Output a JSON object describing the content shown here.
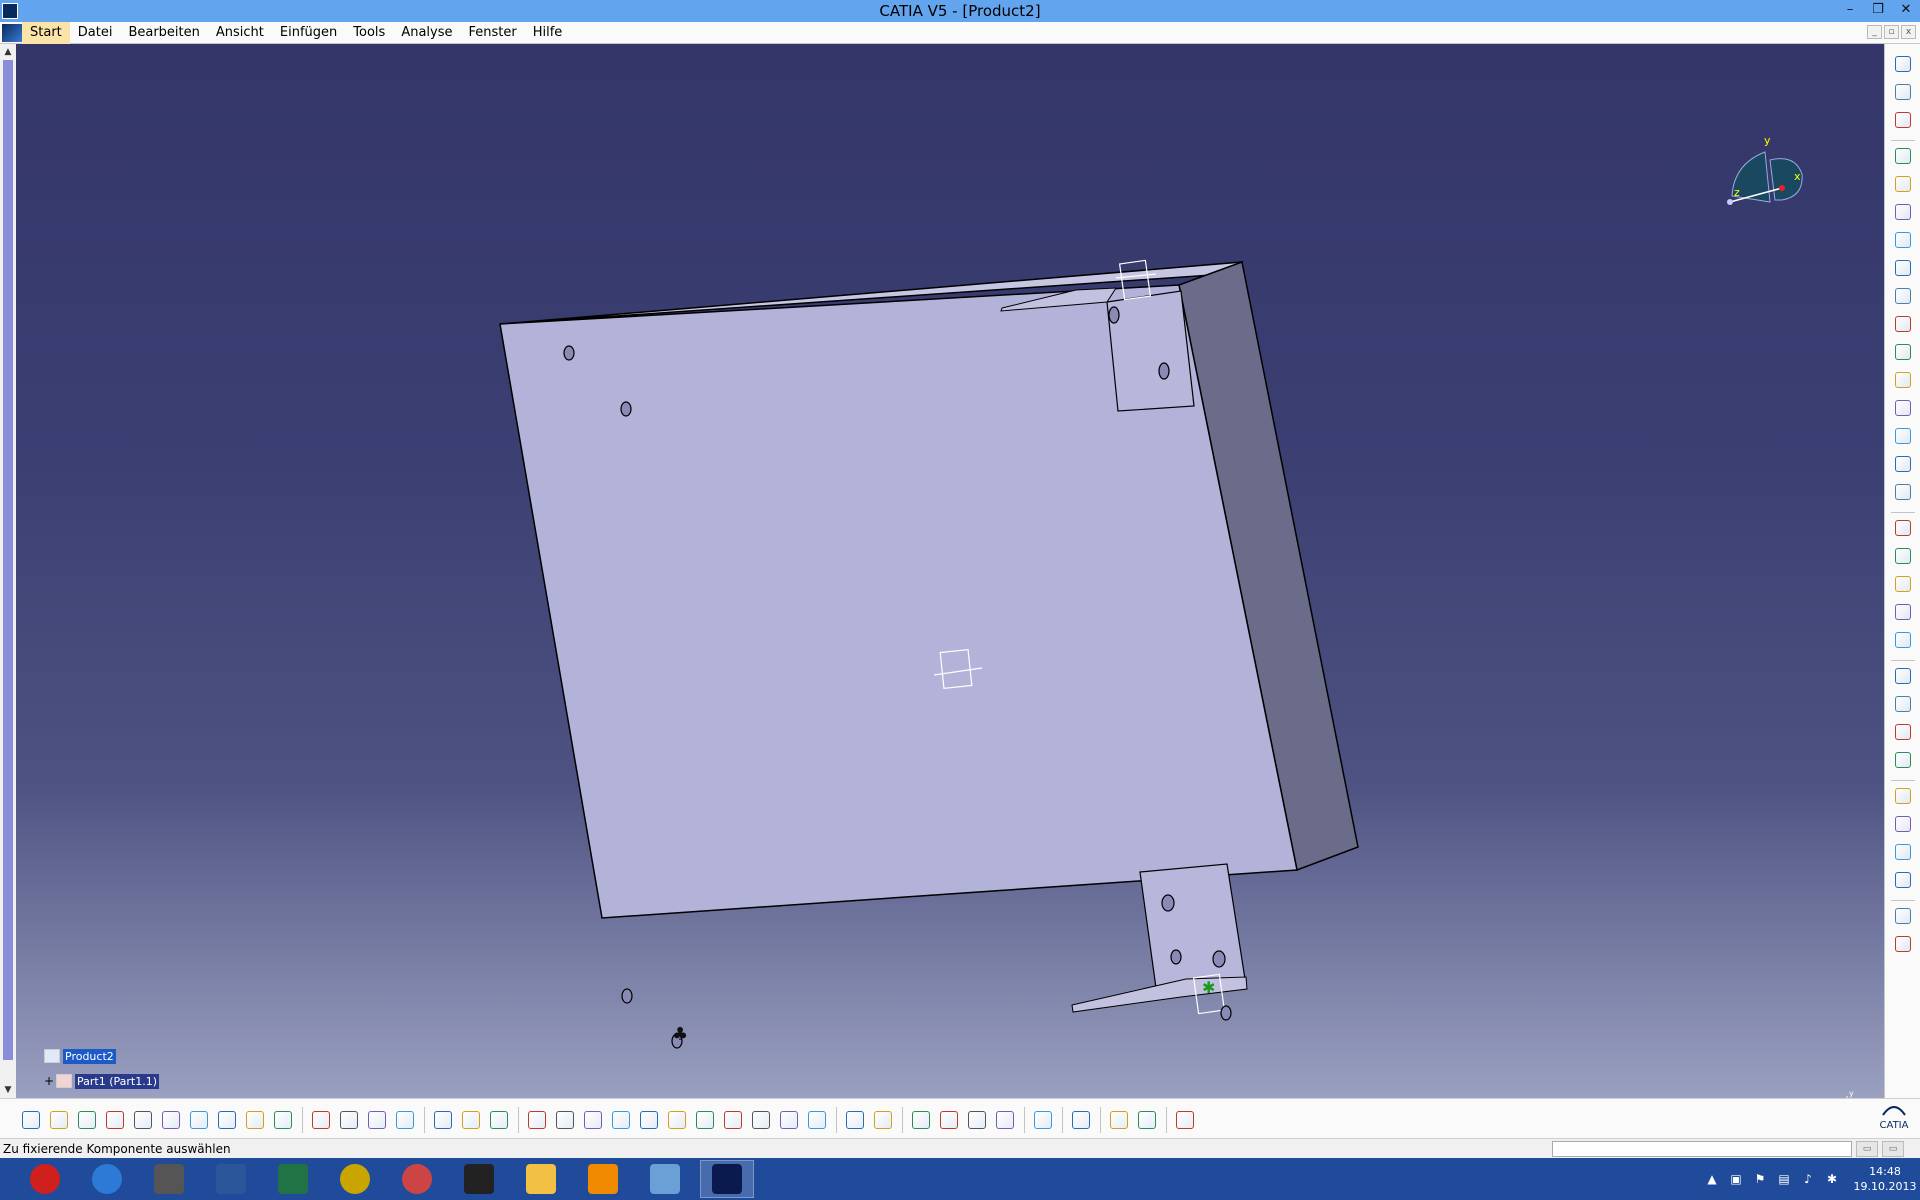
{
  "window": {
    "title": "CATIA V5 - [Product2]",
    "controls": {
      "minimize": "–",
      "restore": "❐",
      "close": "✕"
    }
  },
  "menu": {
    "items": [
      "Start",
      "Datei",
      "Bearbeiten",
      "Ansicht",
      "Einfügen",
      "Tools",
      "Analyse",
      "Fenster",
      "Hilfe"
    ],
    "active": "Start"
  },
  "tree": {
    "root": "Product2",
    "child": "Part1 (Part1.1)",
    "expander": "+"
  },
  "compass": {
    "x_label": "x",
    "y_label": "y",
    "z_label": "z"
  },
  "corner_axis": {
    "x_label": "x",
    "y_label": "y",
    "z_label": "z"
  },
  "status": {
    "message": "Zu fixierende Komponente auswählen",
    "input_value": ""
  },
  "logo": {
    "brand": "CATIA"
  },
  "clock": {
    "time": "14:48",
    "date": "19.10.2013"
  },
  "colors": {
    "titlebar": "#63a4ee",
    "part_face": "#b3b3da",
    "part_side": "#6b6b8a",
    "part_top": "#c6c6e2",
    "taskbar": "#1f4b9a",
    "selection": "#1c5ac8"
  },
  "right_toolbar_icons": [
    "gears-icon",
    "select-arrow-icon",
    "manipulate-icon",
    "new-component-icon",
    "new-product-icon",
    "new-part-icon",
    "existing-component-icon",
    "replace-component-icon",
    "graph-tree-icon",
    "generate-numbering-icon",
    "multi-instantiation-icon",
    "fast-multi-instantiation-icon",
    "reuse-pattern-icon",
    "explode-icon",
    "stop-manipulate-icon",
    "snap-icon",
    "smart-move-icon",
    "compass-manipulate-icon",
    "coincidence-constraint-icon",
    "contact-constraint-icon",
    "offset-constraint-icon",
    "angle-constraint-icon",
    "fix-component-icon",
    "fix-together-icon",
    "quick-constraint-icon",
    "flexible-rigid-icon",
    "change-constraint-icon",
    "reuse-constraint-icon",
    "catalog-icon",
    "bill-of-material-icon",
    "update-icon"
  ],
  "bottom_toolbar_icons": [
    "new-icon",
    "open-icon",
    "save-icon",
    "print-icon",
    "cut-icon",
    "copy-icon",
    "paste-icon",
    "undo-icon",
    "redo-icon",
    "whats-this-icon",
    "formula-icon",
    "comment-icon",
    "knowledge-icon",
    "table-icon",
    "analysis-icon",
    "measure-icon",
    "fly-mode-icon",
    "fit-all-icon",
    "pan-icon",
    "rotate-icon",
    "zoom-in-icon",
    "zoom-out-icon",
    "normal-view-icon",
    "multi-view-icon",
    "iso-view-icon",
    "shading-icon",
    "hide-show-icon",
    "swap-space-icon",
    "capture-icon",
    "explode-icon",
    "measure-between-icon",
    "measure-item-icon",
    "measure-inertia-icon",
    "update-all-icon",
    "sketch-icon",
    "clash-icon",
    "sectioning-icon",
    "distance-icon",
    "grid-icon"
  ]
}
